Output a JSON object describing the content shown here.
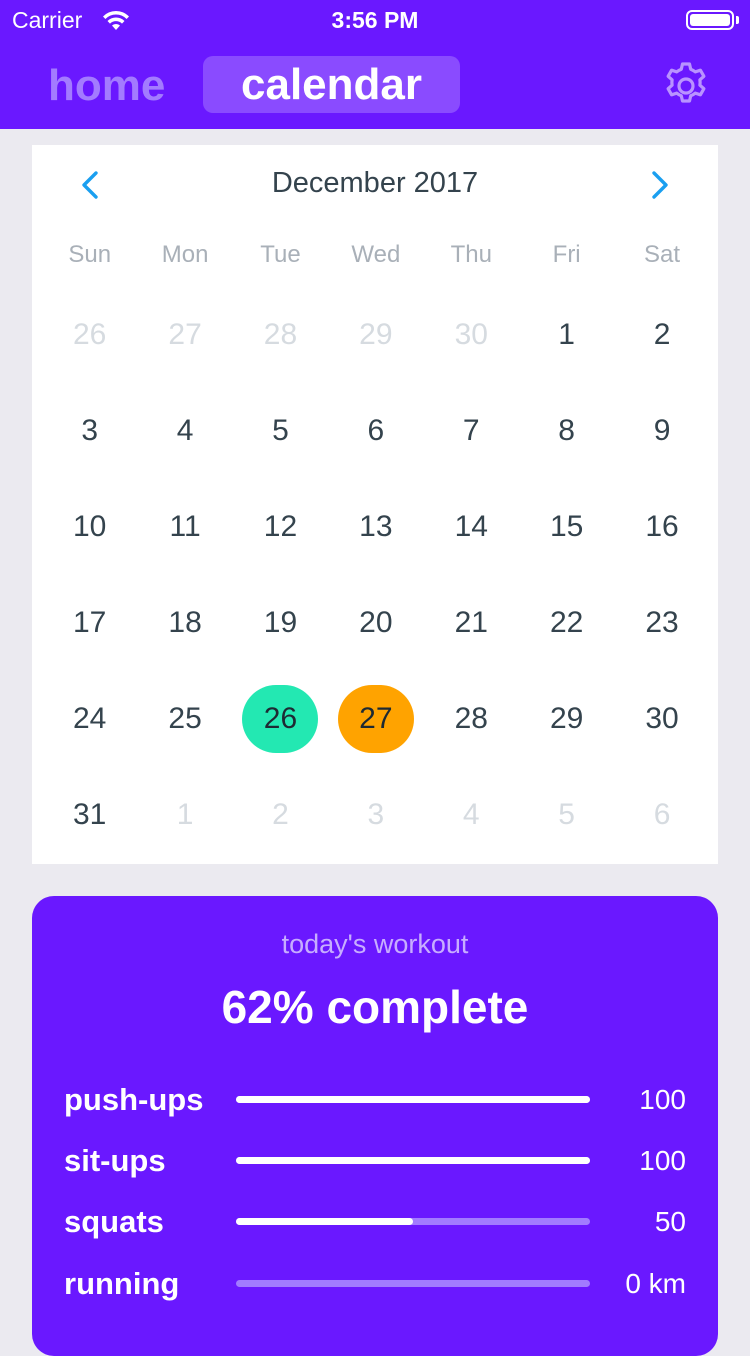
{
  "status_bar": {
    "carrier": "Carrier",
    "time": "3:56 PM"
  },
  "nav": {
    "home_label": "home",
    "calendar_label": "calendar",
    "settings_icon": "gear-icon"
  },
  "calendar": {
    "month_title": "December 2017",
    "prev_icon": "chevron-left-icon",
    "next_icon": "chevron-right-icon",
    "weekdays": [
      "Sun",
      "Mon",
      "Tue",
      "Wed",
      "Thu",
      "Fri",
      "Sat"
    ],
    "weeks": [
      [
        {
          "d": "26",
          "m": true
        },
        {
          "d": "27",
          "m": true
        },
        {
          "d": "28",
          "m": true
        },
        {
          "d": "29",
          "m": true
        },
        {
          "d": "30",
          "m": true
        },
        {
          "d": "1"
        },
        {
          "d": "2"
        }
      ],
      [
        {
          "d": "3"
        },
        {
          "d": "4"
        },
        {
          "d": "5"
        },
        {
          "d": "6"
        },
        {
          "d": "7"
        },
        {
          "d": "8"
        },
        {
          "d": "9"
        }
      ],
      [
        {
          "d": "10"
        },
        {
          "d": "11"
        },
        {
          "d": "12"
        },
        {
          "d": "13"
        },
        {
          "d": "14"
        },
        {
          "d": "15"
        },
        {
          "d": "16"
        }
      ],
      [
        {
          "d": "17"
        },
        {
          "d": "18"
        },
        {
          "d": "19"
        },
        {
          "d": "20"
        },
        {
          "d": "21"
        },
        {
          "d": "22"
        },
        {
          "d": "23"
        }
      ],
      [
        {
          "d": "24"
        },
        {
          "d": "25"
        },
        {
          "d": "26",
          "sel": "teal"
        },
        {
          "d": "27",
          "sel": "orange"
        },
        {
          "d": "28"
        },
        {
          "d": "29"
        },
        {
          "d": "30"
        }
      ],
      [
        {
          "d": "31"
        },
        {
          "d": "1",
          "m": true
        },
        {
          "d": "2",
          "m": true
        },
        {
          "d": "3",
          "m": true
        },
        {
          "d": "4",
          "m": true
        },
        {
          "d": "5",
          "m": true
        },
        {
          "d": "6",
          "m": true
        }
      ]
    ],
    "colors": {
      "teal": "#23e8b2",
      "orange": "#ffa300"
    }
  },
  "workout": {
    "label": "today's workout",
    "status": "62% complete",
    "exercises": [
      {
        "name": "push-ups",
        "value": "100",
        "progress": 1.0
      },
      {
        "name": "sit-ups",
        "value": "100",
        "progress": 1.0
      },
      {
        "name": "squats",
        "value": "50",
        "progress": 0.5
      },
      {
        "name": "running",
        "value": "0 km",
        "progress": 0.0
      }
    ]
  },
  "colors": {
    "accent": "#6a18ff",
    "background": "#ebeaf0"
  }
}
